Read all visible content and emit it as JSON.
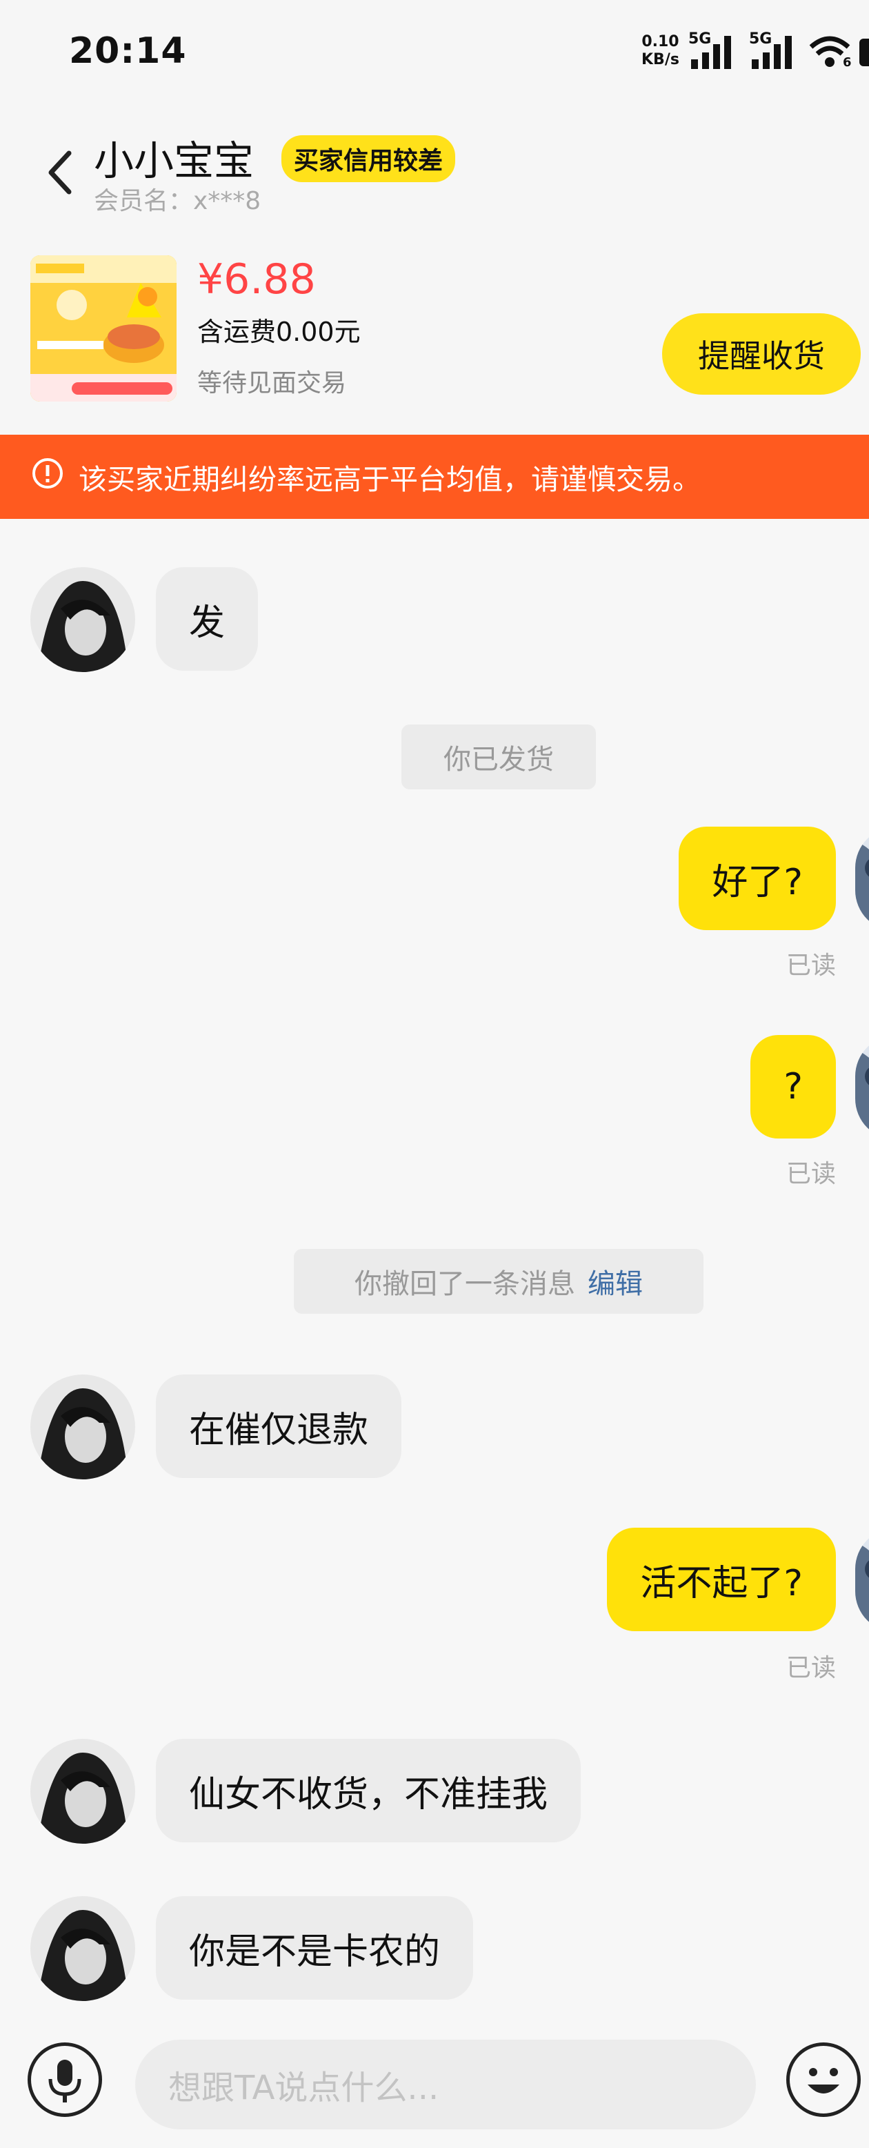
{
  "status_bar": {
    "time": "20:14",
    "net_speed_value": "0.10",
    "net_speed_unit": "KB/s",
    "sim1": "5G",
    "sim2": "5G",
    "wifi_badge": "6"
  },
  "header": {
    "title": "小小宝宝",
    "badge": "买家信用较差",
    "member": "会员名：x***8"
  },
  "product": {
    "price": "¥6.88",
    "shipping": "含运费0.00元",
    "status": "等待见面交易",
    "remind_button": "提醒收货"
  },
  "warning": {
    "text": "该买家近期纠纷率远高于平台均值，请谨慎交易。"
  },
  "messages": [
    {
      "text": "发"
    },
    {
      "text": "你已发货"
    },
    {
      "text": "好了?",
      "read": "已读"
    },
    {
      "text": "?",
      "read": "已读"
    },
    {
      "text": "你撤回了一条消息",
      "action": "编辑"
    },
    {
      "text": "在催仅退款"
    },
    {
      "text": "活不起了?",
      "read": "已读"
    },
    {
      "text": "仙女不收货，不准挂我"
    },
    {
      "text": "你是不是卡农的"
    }
  ],
  "input": {
    "placeholder": "想跟TA说点什么..."
  },
  "colors": {
    "accent_yellow": "#ffe10a",
    "warning_orange": "#ff5a1f",
    "price_red": "#ff4445"
  }
}
